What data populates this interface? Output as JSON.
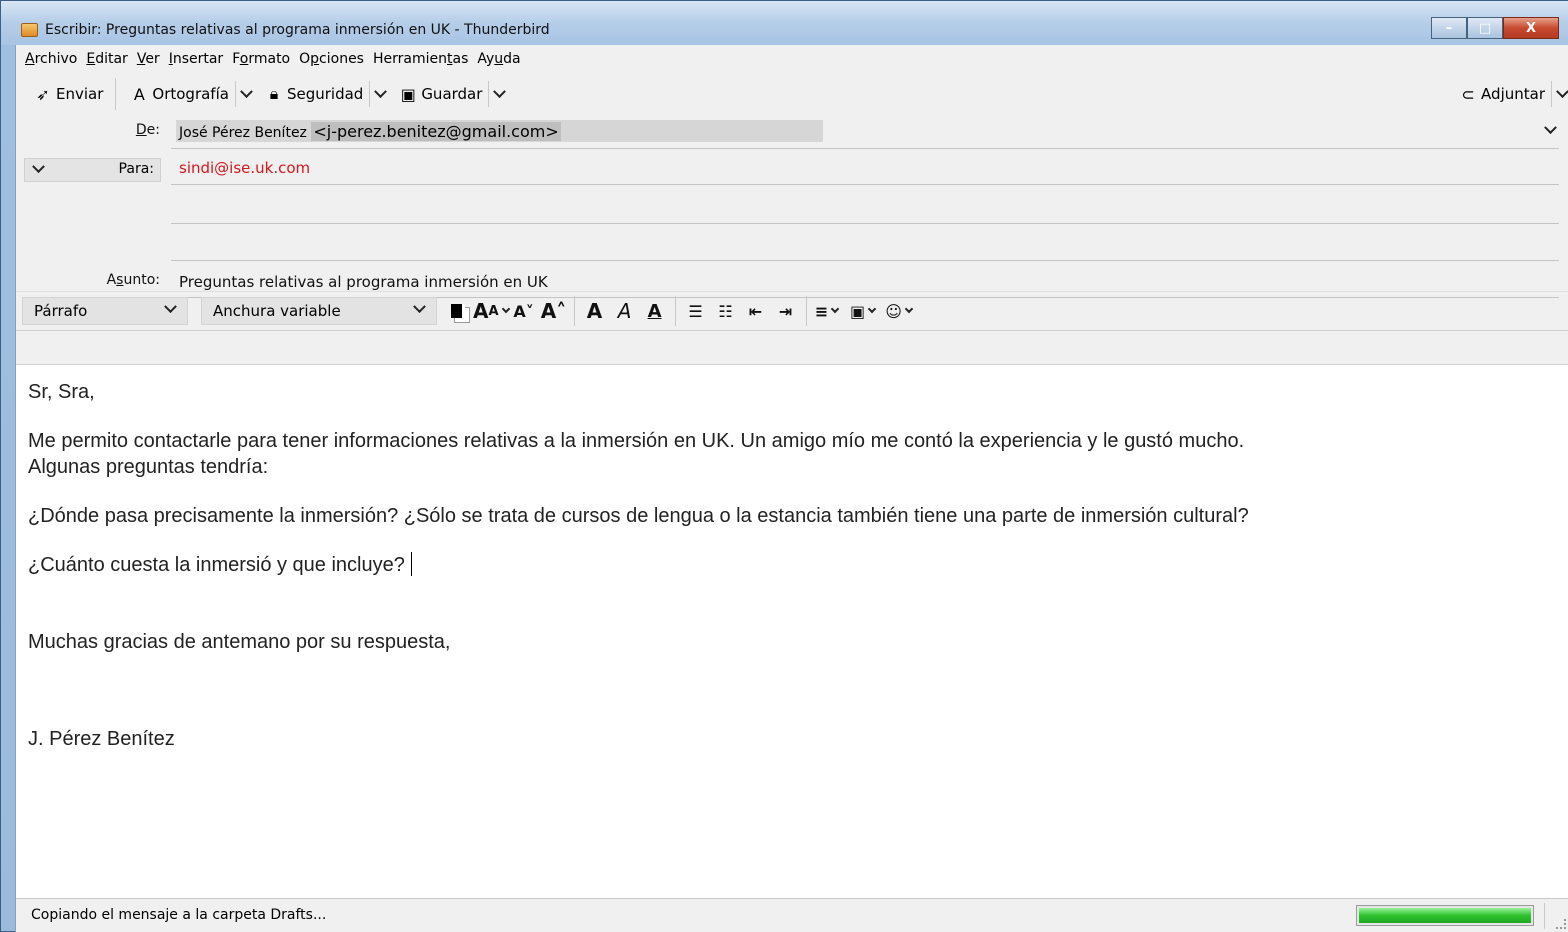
{
  "window": {
    "title": "Escribir: Preguntas relativas al programa inmersión en UK - Thunderbird",
    "minimize": "–",
    "maximize": "□",
    "close": "X"
  },
  "menubar": {
    "items": [
      {
        "acc": "A",
        "rest": "rchivo"
      },
      {
        "acc": "E",
        "rest": "ditar"
      },
      {
        "acc": "V",
        "rest": "er"
      },
      {
        "acc": "I",
        "rest": "nsertar"
      },
      {
        "pre": "F",
        "acc": "o",
        "rest": "rmato"
      },
      {
        "pre": "O",
        "acc": "p",
        "rest": "ciones"
      },
      {
        "pre": "Herramien",
        "acc": "t",
        "rest": "as"
      },
      {
        "pre": "Ay",
        "acc": "u",
        "rest": "da"
      }
    ]
  },
  "toolbar": {
    "send": "Enviar",
    "spelling": "Ortografía",
    "security": "Seguridad",
    "save": "Guardar",
    "attach": "Adjuntar"
  },
  "header": {
    "from_label_acc": "D",
    "from_label_rest": "e:",
    "from_name": "José Pérez Benítez",
    "from_email": "<j-perez.benitez@gmail.com>",
    "to_label": "Para:",
    "to_value": "sindi@ise.uk.com",
    "subject_label_pre": "A",
    "subject_label_acc": "s",
    "subject_label_rest": "unto:",
    "subject_value": "Preguntas relativas al programa inmersión en UK"
  },
  "format": {
    "paragraph": "Párrafo",
    "font": "Anchura variable"
  },
  "body": {
    "greeting": "Sr, Sra,",
    "line1": "Me permito contactarle para tener informaciones relativas a la inmersión en UK. Un amigo mío me contó la experiencia y le gustó mucho.",
    "line2": "Algunas preguntas tendría:",
    "question1": "¿Dónde pasa precisamente la inmersión?  ¿Sólo se trata de cursos de lengua o la estancia también tiene una parte de inmersión cultural?",
    "question2": "¿Cuánto cuesta la inmersió y que incluye?",
    "closing": "Muchas gracias de antemano por su respuesta,",
    "signature": "J. Pérez Benítez"
  },
  "status": {
    "text": "Copiando el mensaje a la carpeta Drafts...",
    "progress": 1.0
  },
  "colors": {
    "recipient": "#d0181e",
    "progress": "#2ec22e"
  }
}
